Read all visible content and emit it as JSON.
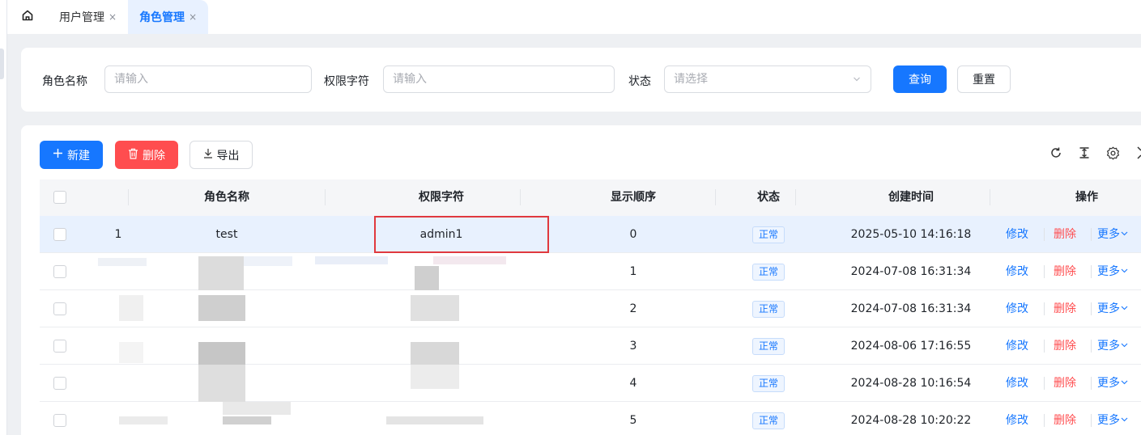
{
  "tabs": {
    "home_icon": "home-icon",
    "items": [
      {
        "label": "用户管理",
        "close": "×",
        "active": false
      },
      {
        "label": "角色管理",
        "close": "×",
        "active": true
      }
    ]
  },
  "search": {
    "role_name_label": "角色名称",
    "role_name_placeholder": "请输入",
    "perm_label": "权限字符",
    "perm_placeholder": "请输入",
    "status_label": "状态",
    "status_placeholder": "请选择",
    "query_button": "查询",
    "reset_button": "重置"
  },
  "toolbar": {
    "new_button": "新建",
    "delete_button": "删除",
    "export_button": "导出",
    "icons": [
      "refresh-icon",
      "column-height-icon",
      "settings-icon",
      "fullscreen-icon"
    ]
  },
  "table": {
    "columns": [
      "",
      "",
      "角色名称",
      "权限字符",
      "显示顺序",
      "状态",
      "创建时间",
      "操作"
    ],
    "rows": [
      {
        "index": "1",
        "name": "test",
        "perm": "admin1",
        "order": "0",
        "status": "正常",
        "created": "2025-05-10 14:16:18"
      },
      {
        "index": "",
        "name": "",
        "perm": "",
        "order": "1",
        "status": "正常",
        "created": "2024-07-08 16:31:34"
      },
      {
        "index": "",
        "name": "",
        "perm": "",
        "order": "2",
        "status": "正常",
        "created": "2024-07-08 16:31:34"
      },
      {
        "index": "",
        "name": "",
        "perm": "",
        "order": "3",
        "status": "正常",
        "created": "2024-08-06 17:16:55"
      },
      {
        "index": "",
        "name": "",
        "perm": "",
        "order": "4",
        "status": "正常",
        "created": "2024-08-28 10:16:54"
      },
      {
        "index": "",
        "name": "",
        "perm": "",
        "order": "5",
        "status": "正常",
        "created": "2024-08-28 10:20:22"
      }
    ],
    "actions": {
      "edit": "修改",
      "delete": "删除",
      "more": "更多"
    }
  },
  "colors": {
    "primary": "#1677ff",
    "danger": "#ff4d4f",
    "highlight_row": "#e8f1fe",
    "annotation_box": "#e0393e"
  }
}
